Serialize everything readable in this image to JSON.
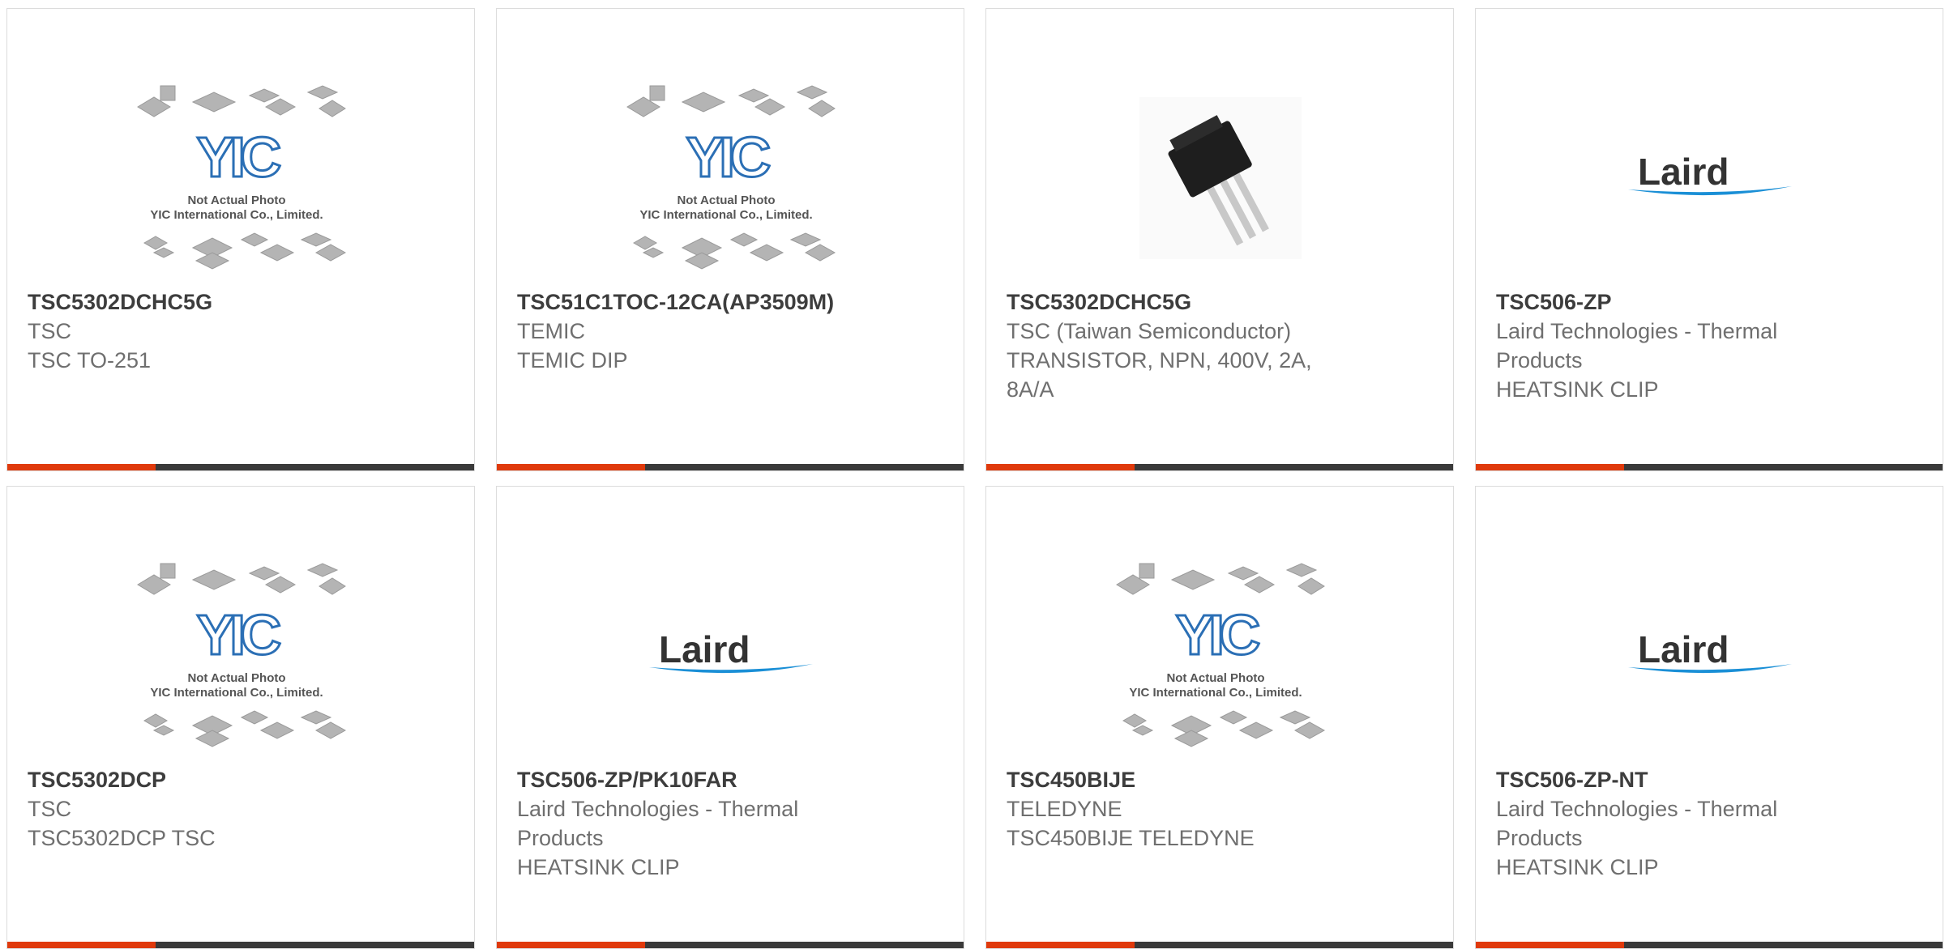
{
  "products": [
    {
      "part_number": "TSC5302DCHC5G",
      "manufacturer": "TSC",
      "description": "TSC TO-251",
      "image": "yic-placeholder-image",
      "placeholder": {
        "line1": "Not Actual Photo",
        "line2": "YIC International Co., Limited.",
        "logo_text": "YIC"
      }
    },
    {
      "part_number": "TSC51C1TOC-12CA(AP3509M)",
      "manufacturer": "TEMIC",
      "description": "TEMIC DIP",
      "image": "yic-placeholder-image",
      "placeholder": {
        "line1": "Not Actual Photo",
        "line2": "YIC International Co., Limited.",
        "logo_text": "YIC"
      }
    },
    {
      "part_number": "TSC5302DCHC5G",
      "manufacturer": "TSC (Taiwan Semiconductor)",
      "description": "TRANSISTOR, NPN, 400V, 2A, 8A/A",
      "image": "transistor-photo"
    },
    {
      "part_number": "TSC506-ZP",
      "manufacturer": "Laird Technologies - Thermal Products",
      "description": "HEATSINK CLIP",
      "image": "laird-logo",
      "logo_text": "Laird"
    },
    {
      "part_number": "TSC5302DCP",
      "manufacturer": "TSC",
      "description": "TSC5302DCP TSC",
      "image": "yic-placeholder-image",
      "placeholder": {
        "line1": "Not Actual Photo",
        "line2": "YIC International Co., Limited.",
        "logo_text": "YIC"
      }
    },
    {
      "part_number": "TSC506-ZP/PK10FAR",
      "manufacturer": "Laird Technologies - Thermal Products",
      "description": "HEATSINK CLIP",
      "image": "laird-logo",
      "logo_text": "Laird"
    },
    {
      "part_number": "TSC450BIJE",
      "manufacturer": "TELEDYNE",
      "description": "TSC450BIJE TELEDYNE",
      "image": "yic-placeholder-image",
      "placeholder": {
        "line1": "Not Actual Photo",
        "line2": "YIC International Co., Limited.",
        "logo_text": "YIC"
      }
    },
    {
      "part_number": "TSC506-ZP-NT",
      "manufacturer": "Laird Technologies - Thermal Products",
      "description": "HEATSINK CLIP",
      "image": "laird-logo",
      "logo_text": "Laird"
    }
  ],
  "colors": {
    "accent": "#e03a0c",
    "bar": "#3a3a3a",
    "title": "#3d3d3d",
    "muted": "#6f6f6f",
    "yic_blue": "#2b6fb5",
    "laird_blue": "#1a8fd6"
  }
}
